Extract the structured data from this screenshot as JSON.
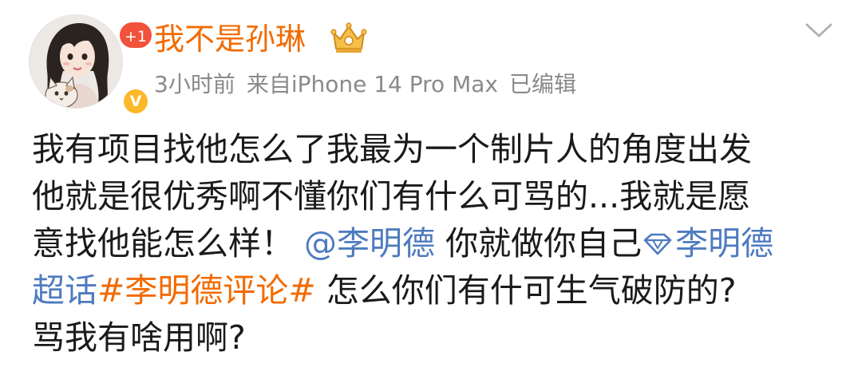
{
  "post": {
    "author": {
      "name": "我不是孙琳",
      "notification_badge": "+1",
      "verified_mark": "V",
      "avatar_icon": "avatar-girl-with-cat",
      "vip_icon": "vip-crown-icon"
    },
    "meta": {
      "time": "3小时前",
      "source": "来自iPhone 14 Pro Max",
      "edited": "已编辑"
    },
    "more_icon": "chevron-down-icon",
    "content": {
      "line1": "我有项目找他怎么了我最为一个制片人的角度出发",
      "line2": "他就是很优秀啊不懂你们有什么可骂的...我就是愿",
      "line3_text": "意找他能怎么样！",
      "mention": "@李明德",
      "line3_after_mention": "你就做你自己",
      "superchat_icon": "diamond-icon",
      "superchat_part1": "李明德",
      "superchat_part2": "超话",
      "topic": "#李明德评论#",
      "line4_after_topic": "怎么你们有什可生气破防的?",
      "line5": "骂我有啥用啊?"
    }
  },
  "colors": {
    "username": "#f26b00",
    "link": "#4e7bbf",
    "topic": "#f26b00",
    "meta": "#8a8a8a",
    "text": "#1a1a1a",
    "badge_plus": "#f2513b",
    "verified": "#fbb829"
  }
}
